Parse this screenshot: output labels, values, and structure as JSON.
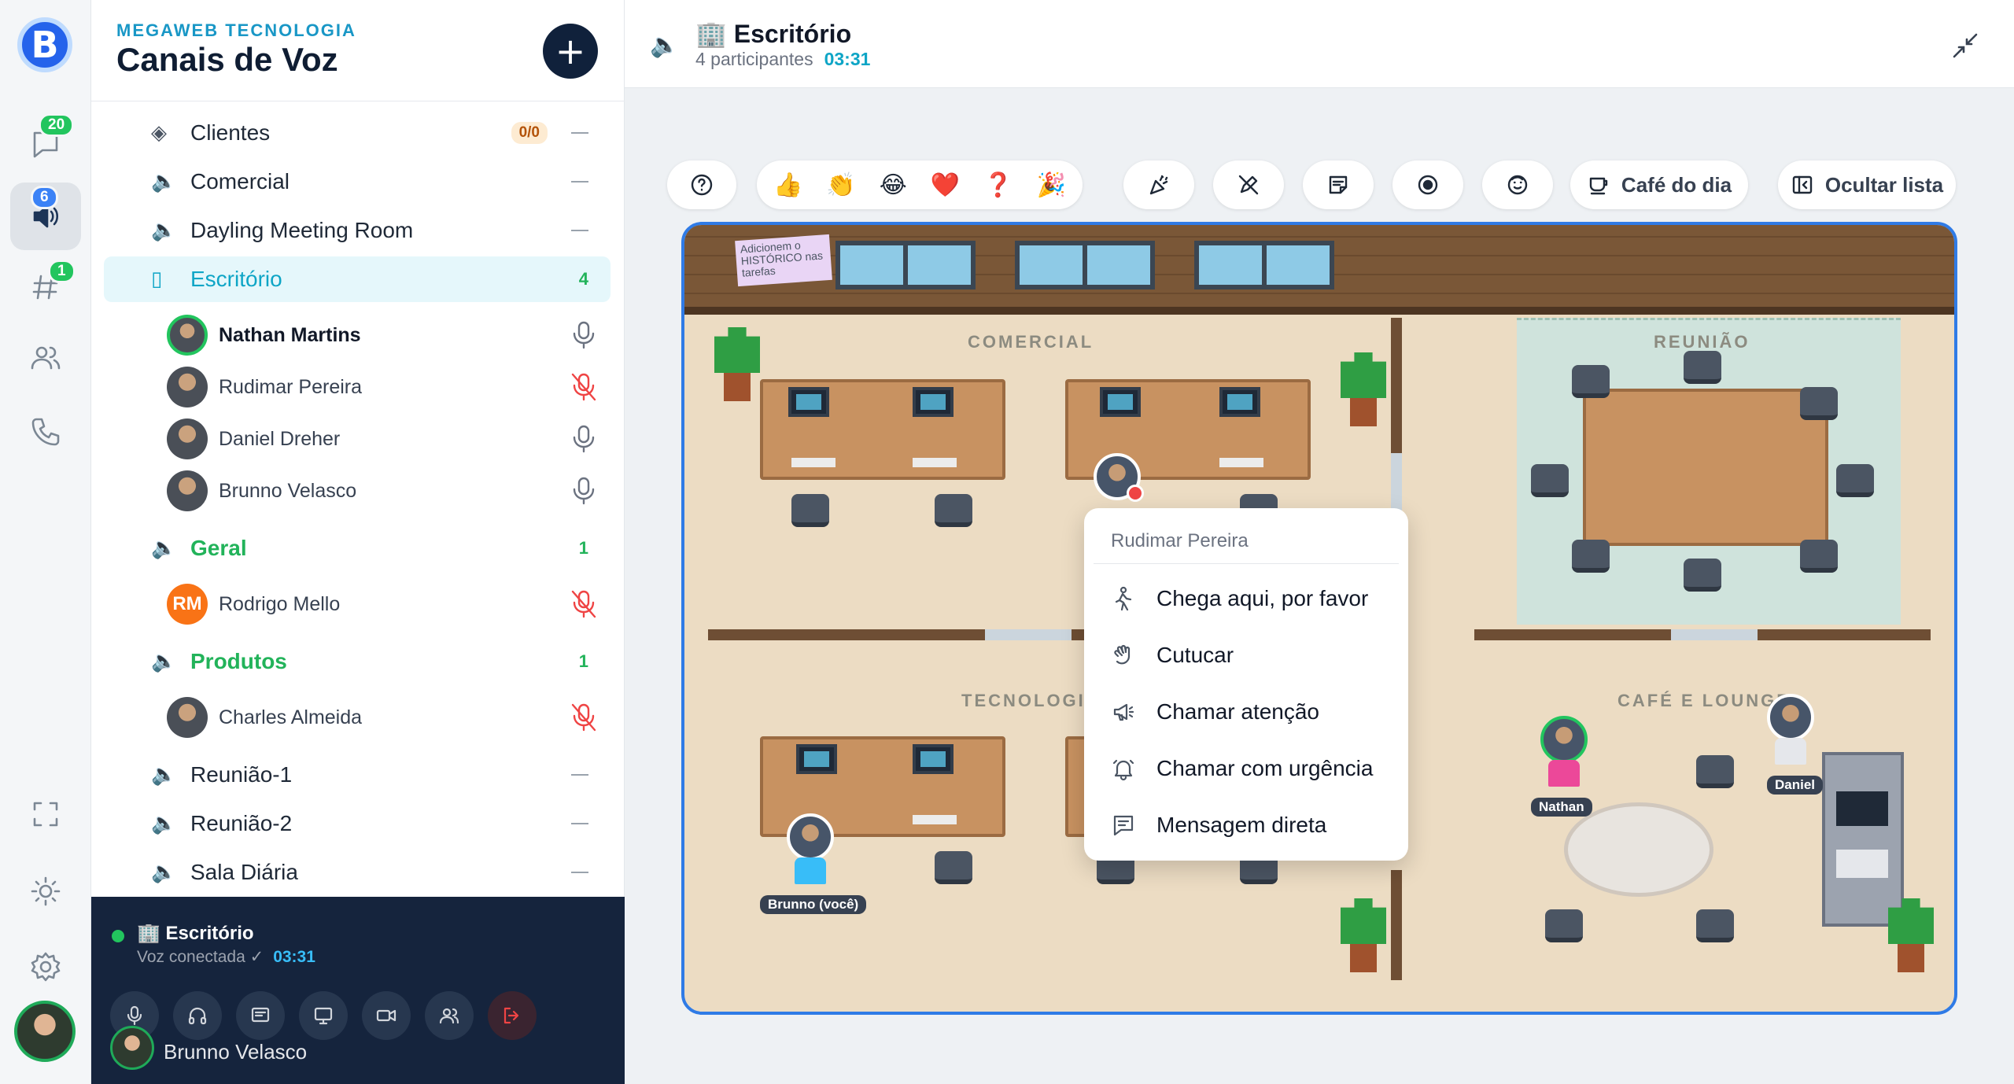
{
  "rail": {
    "logo_letter": "B",
    "messages_badge": "20",
    "voice_badge": "6",
    "channels_badge": "1"
  },
  "panel": {
    "org": "MEGAWEB TECNOLOGIA",
    "title": "Canais de Voz",
    "add_label": "+",
    "channels": [
      {
        "name": "Clientes",
        "pill": "0/0"
      },
      {
        "name": "Comercial"
      },
      {
        "name": "Dayling Meeting Room"
      },
      {
        "name": "Escritório",
        "count": "4"
      },
      {
        "name": "Geral",
        "count": "1"
      },
      {
        "name": "Produtos",
        "count": "1"
      },
      {
        "name": "Reunião-1"
      },
      {
        "name": "Reunião-2"
      },
      {
        "name": "Sala Diária"
      }
    ],
    "members": [
      {
        "name": "Nathan Martins",
        "mic": "on"
      },
      {
        "name": "Rudimar Pereira",
        "mic": "muted"
      },
      {
        "name": "Daniel Dreher",
        "mic": "on"
      },
      {
        "name": "Brunno Velasco",
        "mic": "on"
      },
      {
        "name": "Rodrigo Mello",
        "initials": "RM",
        "mic": "muted"
      },
      {
        "name": "Charles Almeida",
        "mic": "muted"
      }
    ]
  },
  "voice_footer": {
    "room": "🏢 Escritório",
    "status": "Voz conectada ✓",
    "time": "03:31",
    "user": "Brunno Velasco"
  },
  "header": {
    "room": "🏢 Escritório",
    "participants": "4 participantes",
    "time": "03:31"
  },
  "toolbar": {
    "emojis": [
      "👍",
      "👏",
      "😂",
      "❤️",
      "❓",
      "🎉"
    ],
    "cafe_label": "Café do dia",
    "hide_label": "Ocultar lista"
  },
  "map": {
    "sticky_note": "Adicionem o HISTÓRICO nas tarefas",
    "rooms": [
      "COMERCIAL",
      "REUNIÃO",
      "TECNOLOGIA",
      "CAFÉ E LOUNGE"
    ],
    "labels": {
      "nathan": "Nathan",
      "daniel": "Daniel",
      "brunno": "Brunno (você)"
    }
  },
  "context_menu": {
    "header": "Rudimar Pereira",
    "items": [
      "Chega aqui, por favor",
      "Cutucar",
      "Chamar atenção",
      "Chamar com urgência",
      "Mensagem direta"
    ]
  },
  "colors": {
    "accent": "#0ea5c6",
    "green": "#22b35a",
    "navy": "#15243d",
    "mute_red": "#ef4444",
    "map_border": "#2f7be6"
  }
}
